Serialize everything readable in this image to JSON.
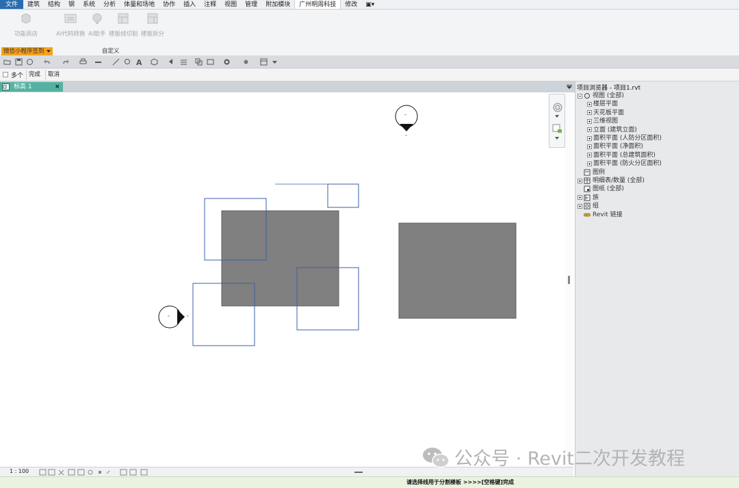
{
  "ribbon_tabs": [
    "文件",
    "建筑",
    "结构",
    "钢",
    "系统",
    "分析",
    "体量和场地",
    "协作",
    "插入",
    "注释",
    "视图",
    "管理",
    "附加模块",
    "广州明周科技",
    "修改",
    "▣▾"
  ],
  "ribbon_buttons": [
    {
      "icon": "store-icon",
      "label": "功能商店"
    },
    {
      "icon": "ai-code-icon",
      "label": "AI代码转换"
    },
    {
      "icon": "ai-assistant-icon",
      "label": "AI助手"
    },
    {
      "icon": "slab-cut-icon",
      "label": "楼板线切割"
    },
    {
      "icon": "slab-split-icon",
      "label": "楼板拆分"
    }
  ],
  "panels": {
    "wechat": "微信小程序签到",
    "custom": "自定义"
  },
  "options_bar": {
    "multiple": "多个",
    "finish": "完成",
    "cancel": "取消"
  },
  "view_tab": {
    "label": "标高 1",
    "close": "×"
  },
  "canvas": {
    "elevation_marker_top": "-",
    "elevation_marker_left": "-",
    "elevation_marker_top_sub": "-",
    "elevation_marker_left_sub": "-"
  },
  "view_bar": {
    "scale": "1 : 100"
  },
  "browser": {
    "title": "项目浏览器 - 项目1.rvt",
    "items": [
      {
        "label": "视图 (全部)",
        "level": 0,
        "toggle": "minus",
        "icon": "views-icon"
      },
      {
        "label": "楼层平面",
        "level": 1,
        "toggle": "plus"
      },
      {
        "label": "天花板平面",
        "level": 1,
        "toggle": "plus"
      },
      {
        "label": "三维视图",
        "level": 1,
        "toggle": "plus"
      },
      {
        "label": "立面 (建筑立面)",
        "level": 1,
        "toggle": "plus"
      },
      {
        "label": "面积平面 (人防分区面积)",
        "level": 1,
        "toggle": "plus"
      },
      {
        "label": "面积平面 (净面积)",
        "level": 1,
        "toggle": "plus"
      },
      {
        "label": "面积平面 (总建筑面积)",
        "level": 1,
        "toggle": "plus"
      },
      {
        "label": "面积平面 (防火分区面积)",
        "level": 1,
        "toggle": "plus"
      },
      {
        "label": "图例",
        "level": 0,
        "toggle": "none",
        "icon": "legend-icon"
      },
      {
        "label": "明细表/数量 (全部)",
        "level": 0,
        "toggle": "plus",
        "icon": "schedule-icon"
      },
      {
        "label": "图纸 (全部)",
        "level": 0,
        "toggle": "none",
        "icon": "sheet-icon"
      },
      {
        "label": "族",
        "level": 0,
        "toggle": "plus",
        "icon": "family-icon"
      },
      {
        "label": "组",
        "level": 0,
        "toggle": "plus",
        "icon": "group-icon"
      },
      {
        "label": "Revit 链接",
        "level": 0,
        "toggle": "none",
        "icon": "link-icon"
      }
    ]
  },
  "status": "请选择线用于分割楼板 >>>>[空格键]完成",
  "watermark": "公众号 · Revit二次开发教程",
  "colors": {
    "file_tab": "#2b6cb0",
    "view_tab": "#55b2a3",
    "slab_fill": "#808080",
    "sketch_line": "#3a5fa8",
    "panel_orange": "#f5a21b"
  }
}
